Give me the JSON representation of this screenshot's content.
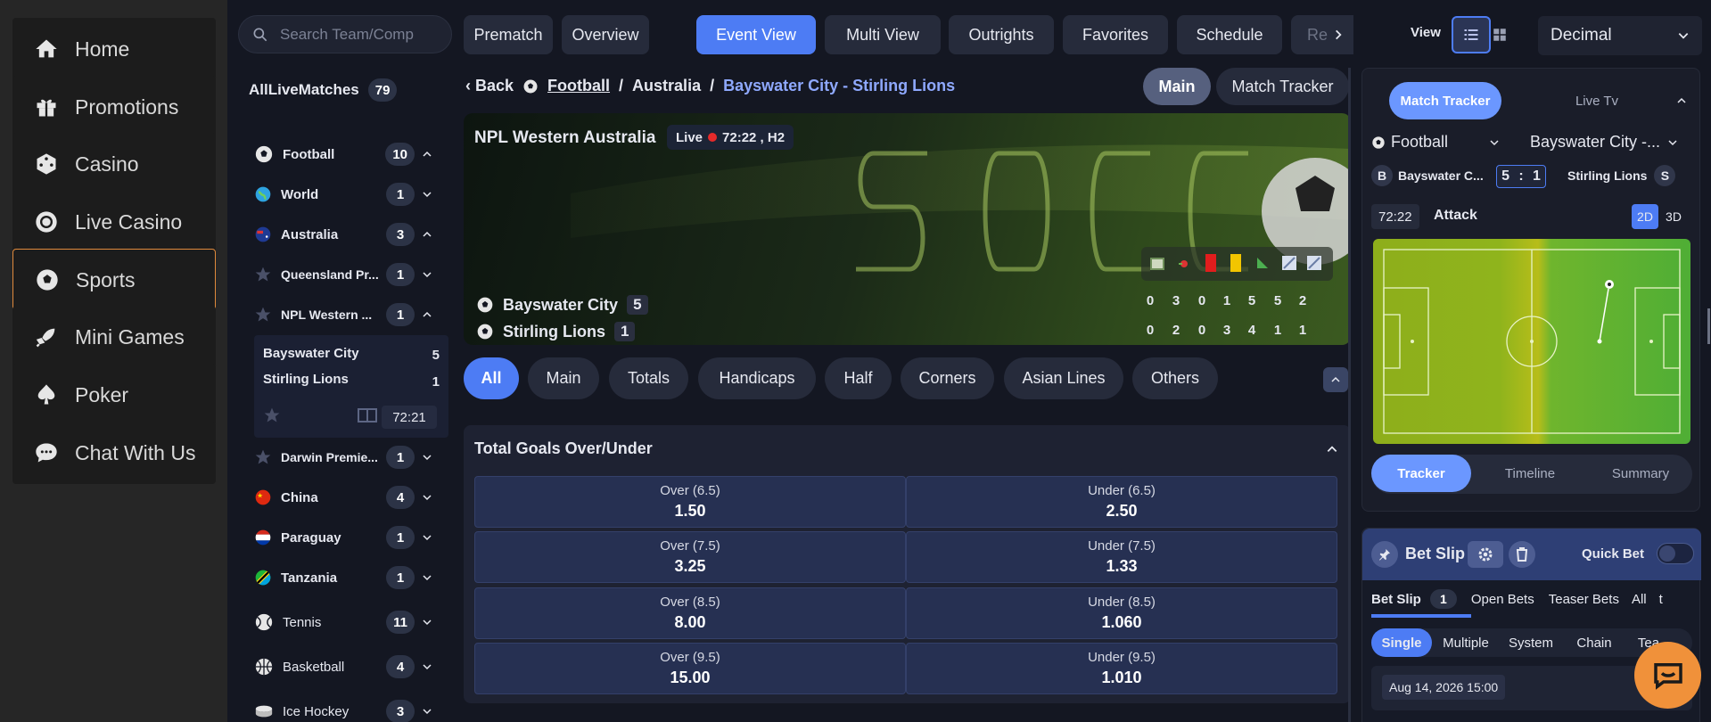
{
  "nav": [
    {
      "label": "Home",
      "icon": "home-icon"
    },
    {
      "label": "Promotions",
      "icon": "gift-icon"
    },
    {
      "label": "Casino",
      "icon": "dice-icon"
    },
    {
      "label": "Live Casino",
      "icon": "chip-icon"
    },
    {
      "label": "Sports",
      "icon": "soccer-ball-icon",
      "active": true
    },
    {
      "label": "Mini Games",
      "icon": "rocket-icon"
    },
    {
      "label": "Poker",
      "icon": "spade-icon"
    },
    {
      "label": "Chat With Us",
      "icon": "chat-bubble-icon"
    }
  ],
  "search": {
    "placeholder": "Search Team/Comp"
  },
  "tabs": [
    "Prematch",
    "Overview",
    "Event View",
    "Multi View",
    "Outrights",
    "Favorites",
    "Schedule",
    "Re"
  ],
  "active_tab": "Event View",
  "view": {
    "label": "View",
    "odds_format": "Decimal"
  },
  "matchlist": {
    "title": "AllLiveMatches",
    "count": "79",
    "rows": [
      {
        "label": "Football",
        "count": "10",
        "icon": "soccer-ball-icon",
        "open": true
      },
      {
        "label": "World",
        "count": "1",
        "icon": "globe-icon"
      },
      {
        "label": "Australia",
        "count": "3",
        "icon": "australia-flag-icon",
        "open": true
      },
      {
        "label": "Queensland Pr...",
        "count": "1",
        "icon": "star-icon"
      },
      {
        "label": "NPL Western ...",
        "count": "1",
        "icon": "star-icon",
        "open": true
      },
      {
        "label": "Darwin Premie...",
        "count": "1",
        "icon": "star-icon"
      },
      {
        "label": "China",
        "count": "4",
        "icon": "china-flag-icon"
      },
      {
        "label": "Paraguay",
        "count": "1",
        "icon": "paraguay-flag-icon"
      },
      {
        "label": "Tanzania",
        "count": "1",
        "icon": "tanzania-flag-icon"
      },
      {
        "label": "Tennis",
        "count": "11",
        "icon": "tennis-ball-icon"
      },
      {
        "label": "Basketball",
        "count": "4",
        "icon": "basketball-icon"
      },
      {
        "label": "Ice Hockey",
        "count": "3",
        "icon": "hockey-puck-icon"
      }
    ],
    "live_card": {
      "home": "Bayswater City",
      "home_score": "5",
      "away": "Stirling Lions",
      "away_score": "1",
      "time": "72:21"
    }
  },
  "breadcrumb": {
    "back": "Back",
    "sport": "Football",
    "sep": "/",
    "country": "Australia",
    "event": "Bayswater City - Stirling Lions"
  },
  "view_toggle": {
    "main": "Main",
    "tracker": "Match Tracker"
  },
  "event": {
    "league": "NPL Western Australia",
    "live": "Live",
    "clock": "72:22 , H2",
    "home": "Bayswater City",
    "home_score": "5",
    "away": "Stirling Lions",
    "away_score": "1",
    "stats_icons": [
      "corner-flag-icon",
      "penalty-icon",
      "red-card-icon",
      "yellow-card-icon",
      "corner-icon",
      "shot-on-target-icon",
      "shot-off-target-icon"
    ],
    "stats_home": [
      "0",
      "3",
      "0",
      "1",
      "5",
      "5",
      "2"
    ],
    "stats_away": [
      "0",
      "2",
      "0",
      "3",
      "4",
      "1",
      "1"
    ]
  },
  "categories": [
    "All",
    "Main",
    "Totals",
    "Handicaps",
    "Half",
    "Corners",
    "Asian Lines",
    "Others"
  ],
  "market": {
    "title": "Total Goals Over/Under",
    "rows": [
      {
        "over": "Over (6.5)",
        "over_odd": "1.50",
        "under": "Under (6.5)",
        "under_odd": "2.50"
      },
      {
        "over": "Over (7.5)",
        "over_odd": "3.25",
        "under": "Under (7.5)",
        "under_odd": "1.33"
      },
      {
        "over": "Over (8.5)",
        "over_odd": "8.00",
        "under": "Under (8.5)",
        "under_odd": "1.060"
      },
      {
        "over": "Over (9.5)",
        "over_odd": "15.00",
        "under": "Under (9.5)",
        "under_odd": "1.010"
      }
    ]
  },
  "tracker": {
    "tabs": [
      "Match Tracker",
      "Live Tv"
    ],
    "sport": "Football",
    "match": "Bayswater City -...",
    "home_short": "Bayswater C...",
    "home_badge": "B",
    "score_home": "5",
    "score_sep": ":",
    "score_away": "1",
    "away": "Stirling Lions",
    "away_badge": "S",
    "time": "72:22",
    "state": "Attack",
    "modes": [
      "2D",
      "3D"
    ],
    "bottom_tabs": [
      "Tracker",
      "Timeline",
      "Summary"
    ]
  },
  "betslip": {
    "title": "Bet Slip",
    "quick_bet": "Quick Bet",
    "tabs": [
      "Bet Slip",
      "Open Bets",
      "Teaser Bets",
      "All",
      "t"
    ],
    "tab_count": "1",
    "types": [
      "Single",
      "Multiple",
      "System",
      "Chain",
      "Tea"
    ],
    "date": "Aug 14, 2026 15:00"
  },
  "colors": {
    "accent": "#4d7cf4",
    "active_border": "#e08a3c",
    "chat": "#f0913a"
  }
}
